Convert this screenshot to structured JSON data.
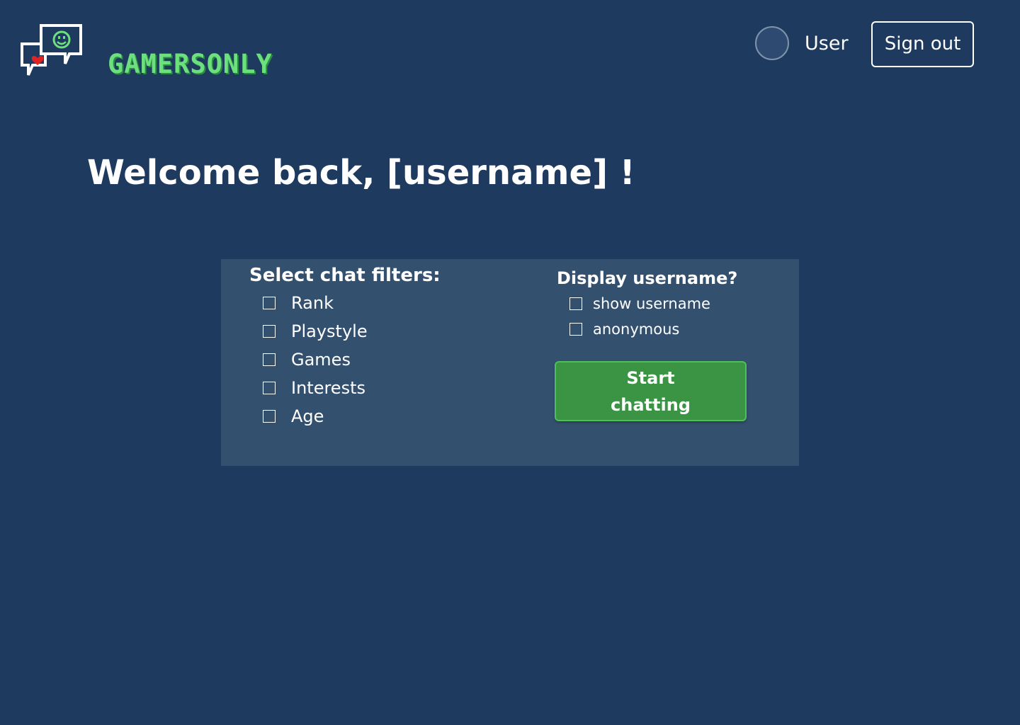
{
  "header": {
    "logo_text": "GAMERSONLY",
    "logo_icon": "chat-bubbles-smiley-heart-icon",
    "user_label": "User",
    "signout_label": "Sign out"
  },
  "main": {
    "welcome_text": "Welcome back, [username] !"
  },
  "filters": {
    "title": "Select chat filters:",
    "items": [
      {
        "label": "Rank",
        "checked": false
      },
      {
        "label": "Playstyle",
        "checked": false
      },
      {
        "label": "Games",
        "checked": false
      },
      {
        "label": "Interests",
        "checked": false
      },
      {
        "label": "Age",
        "checked": false
      }
    ]
  },
  "display": {
    "title": "Display username?",
    "options": [
      {
        "label": "show username",
        "checked": false
      },
      {
        "label": "anonymous",
        "checked": false
      }
    ]
  },
  "start_button": {
    "label": "Start chatting"
  },
  "colors": {
    "background": "#1f3a5f",
    "panel": "#34506f",
    "logo_green": "#6de07e",
    "button_green": "#3a9443"
  }
}
